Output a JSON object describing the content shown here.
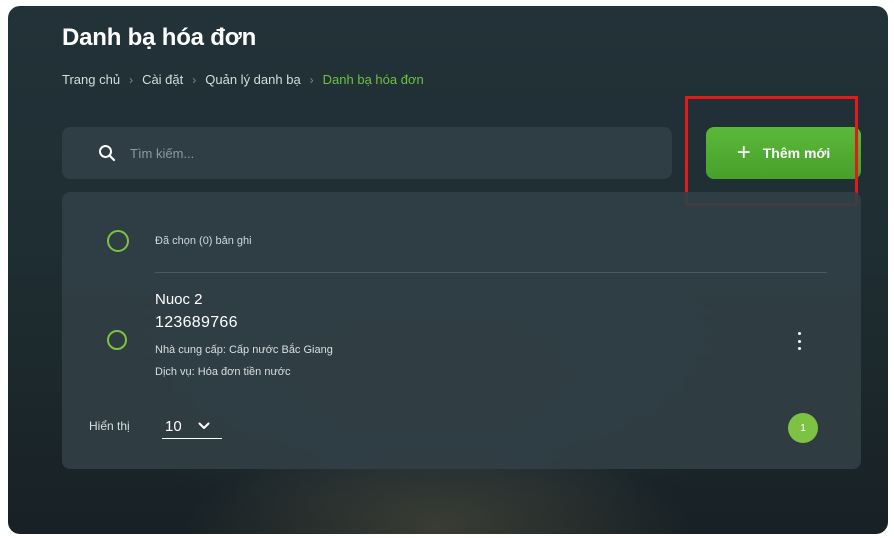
{
  "header": {
    "title": "Danh bạ hóa đơn",
    "breadcrumb": [
      "Trang chủ",
      "Cài đặt",
      "Quản lý danh bạ",
      "Danh bạ hóa đơn"
    ],
    "breadcrumb_separator": "›"
  },
  "toolbar": {
    "search_placeholder": "Tìm kiếm...",
    "search_icon": "search-icon",
    "add_label": "Thêm mới",
    "add_icon": "plus-icon"
  },
  "list": {
    "selected_label": "Đã chọn (0) bản ghi",
    "items": [
      {
        "name": "Nuoc 2",
        "number": "123689766",
        "provider": "Nhà cung cấp: Cấp nước Bắc Giang",
        "service": "Dịch vụ: Hóa đơn tiền nước"
      }
    ]
  },
  "pagination": {
    "page_size_label": "Hiển thị",
    "page_size_value": "10",
    "current_page": "1"
  },
  "colors": {
    "accent": "#6cc142",
    "button": "#52ad33",
    "highlight": "#e01b1b",
    "panel": "#313f45"
  }
}
